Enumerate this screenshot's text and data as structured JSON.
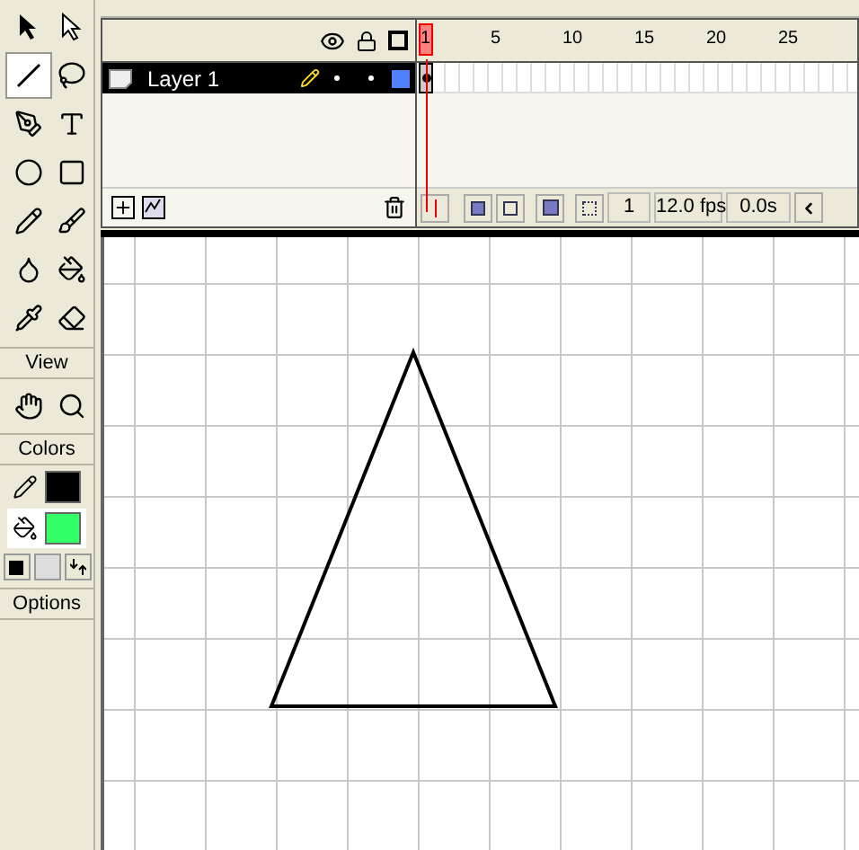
{
  "toolbox": {
    "tools": [
      {
        "kind": "arrow",
        "selected": false
      },
      {
        "kind": "subselect",
        "selected": false
      },
      {
        "kind": "line",
        "selected": true
      },
      {
        "kind": "lasso",
        "selected": false
      },
      {
        "kind": "pen",
        "selected": false
      },
      {
        "kind": "text",
        "selected": false
      },
      {
        "kind": "oval",
        "selected": false
      },
      {
        "kind": "rectangle",
        "selected": false
      },
      {
        "kind": "pencil",
        "selected": false
      },
      {
        "kind": "brush",
        "selected": false
      },
      {
        "kind": "ink",
        "selected": false
      },
      {
        "kind": "bucket",
        "selected": false
      },
      {
        "kind": "dropper",
        "selected": false
      },
      {
        "kind": "eraser",
        "selected": false
      }
    ],
    "view": {
      "label": "View",
      "tools": [
        {
          "kind": "hand",
          "selected": false
        },
        {
          "kind": "zoom",
          "selected": false
        }
      ]
    },
    "colors": {
      "label": "Colors",
      "stroke": {
        "color": "#000000"
      },
      "fill": {
        "color": "#33ff66",
        "selected": true
      }
    },
    "options": {
      "label": "Options"
    }
  },
  "timeline": {
    "layers": [
      {
        "name": "Layer 1",
        "selected": true,
        "color": "#4f81ff"
      }
    ],
    "ruler": [
      "1",
      "5",
      "10",
      "15",
      "20",
      "25"
    ],
    "current_frame": "1",
    "frame_rate": "12.0 fps",
    "elapsed": "0.0s"
  }
}
